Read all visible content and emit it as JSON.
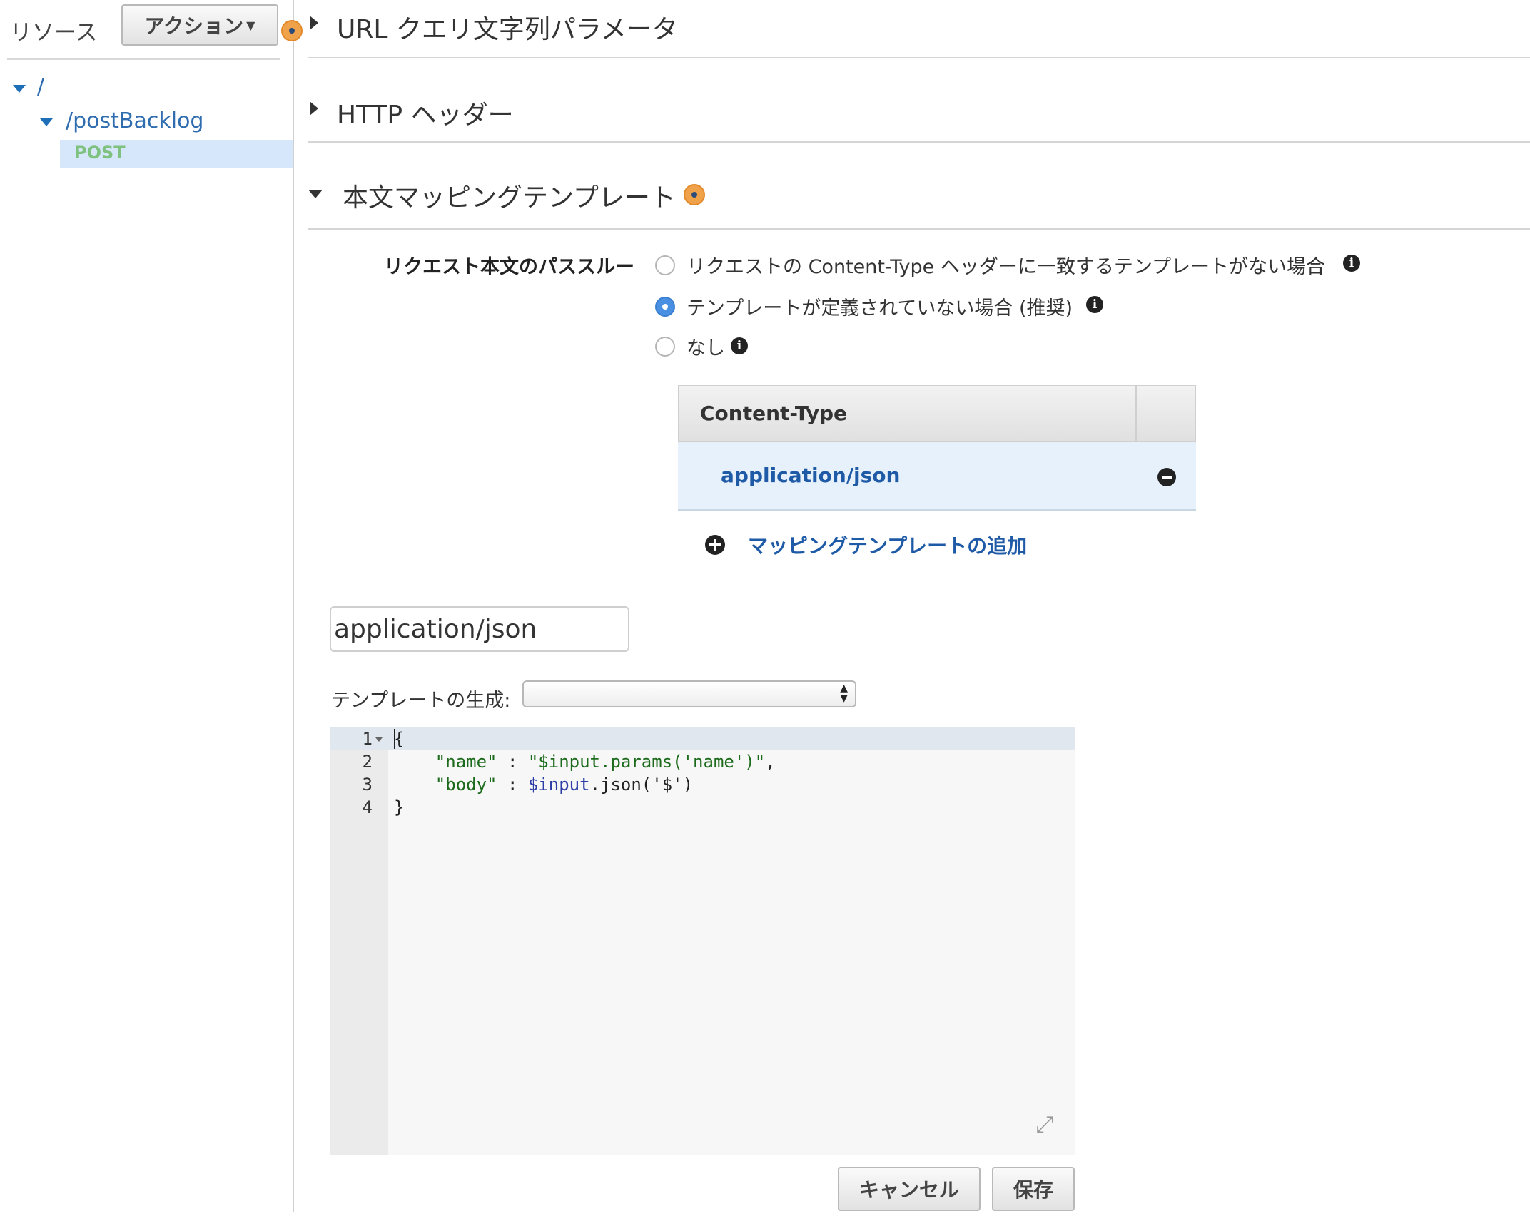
{
  "sidebar": {
    "title": "リソース",
    "action_label": "アクション",
    "tree": {
      "root_label": "/",
      "resource_label": "/postBacklog",
      "method_label": "POST"
    }
  },
  "sections": {
    "url_query": "URL クエリ文字列パラメータ",
    "http_headers": "HTTP ヘッダー",
    "body_mapping": "本文マッピングテンプレート"
  },
  "passthrough": {
    "label": "リクエスト本文のパススルー",
    "options": [
      {
        "label": "リクエストの Content-Type ヘッダーに一致するテンプレートがない場合",
        "checked": false
      },
      {
        "label": "テンプレートが定義されていない場合 (推奨)",
        "checked": true
      },
      {
        "label": "なし",
        "checked": false
      }
    ]
  },
  "content_type_table": {
    "header": "Content-Type",
    "rows": [
      "application/json"
    ]
  },
  "add_mapping_label": "マッピングテンプレートの追加",
  "content_type_input_value": "application/json",
  "generate_template": {
    "label": "テンプレートの生成:",
    "selected": ""
  },
  "editor": {
    "line_numbers": [
      "1",
      "2",
      "3",
      "4"
    ],
    "lines": [
      "{",
      "    \"name\" : \"$input.params('name')\",",
      "    \"body\" : $input.json('$')",
      "}"
    ]
  },
  "buttons": {
    "cancel": "キャンセル",
    "save": "保存"
  },
  "colors": {
    "link": "#1f5aa6",
    "selected_bg": "#d6e7fb",
    "method_green": "#7fc280",
    "help_orange": "#f0a24a",
    "radio_blue": "#4a90e2"
  },
  "icons": {
    "help": "help-circle-icon",
    "info": "info-icon",
    "remove": "minus-circle-icon",
    "add": "plus-circle-icon",
    "expand": "expand-icon"
  }
}
